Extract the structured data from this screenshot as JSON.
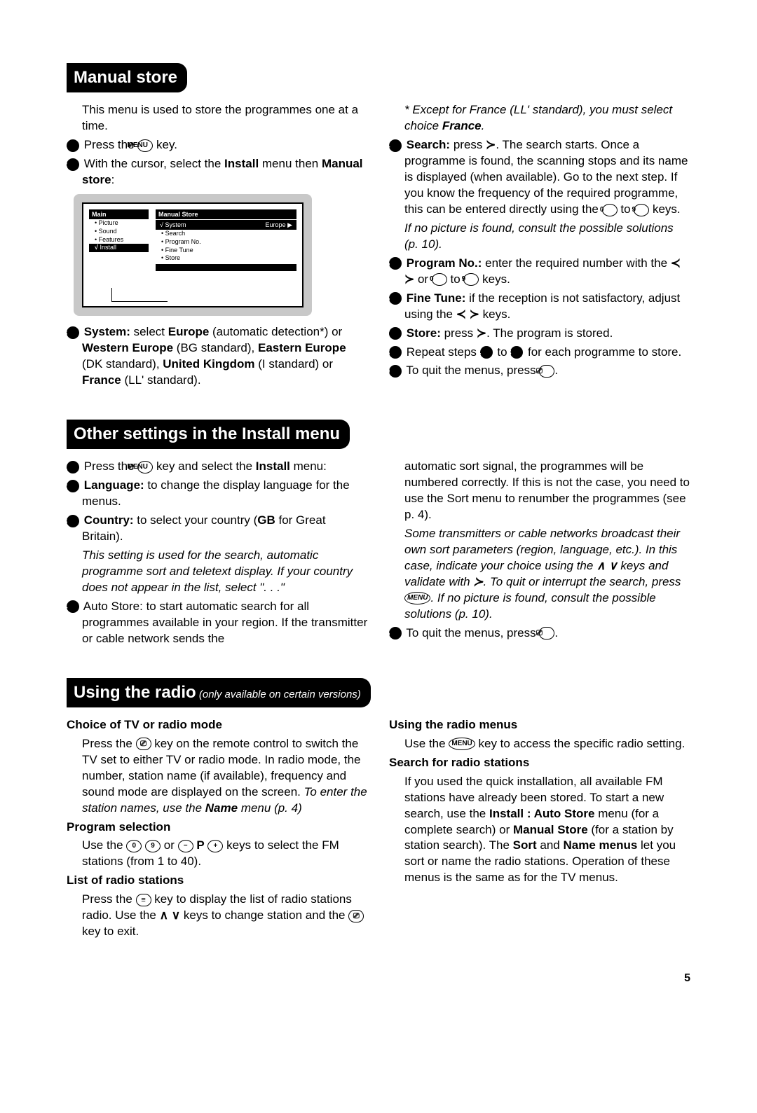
{
  "page_number": "5",
  "s1": {
    "title": "Manual store",
    "left": {
      "intro": "This menu is used to store the programmes one at a time.",
      "step1_a": "Press the ",
      "step1_key": "MENU",
      "step1_b": " key.",
      "step2_a": "With the cursor, select the ",
      "step2_bold1": "Install",
      "step2_b": " menu then ",
      "step2_bold2": "Manual store",
      "step2_c": ":",
      "step3_a": "System:",
      "step3_b": " select ",
      "step3_bold1": "Europe",
      "step3_c": " (automatic detection*) or ",
      "step3_bold2": "Western Europe",
      "step3_d": " (BG standard), ",
      "step3_bold3": "Eastern Europe",
      "step3_e": " (DK standard), ",
      "step3_bold4": "United Kingdom",
      "step3_f": " (I standard) or ",
      "step3_bold5": "France",
      "step3_g": " (LL' standard)."
    },
    "right": {
      "note_a": "* Except for France (LL' standard), you must select choice ",
      "note_bold": "France",
      "note_b": ".",
      "step4_a": "Search:",
      "step4_b": " press ",
      "step4_c": ". The search starts. Once a programme is found, the scanning stops and its name is displayed (when available). Go to the next step. If you know the frequency of the required programme, this can be entered directly using the ",
      "step4_d": " to ",
      "step4_e": " keys.",
      "step4_note": "If no picture is found, consult the possible solutions (p. 10).",
      "step5_a": "Program No.:",
      "step5_b": " enter the required number with the ",
      "step5_c": " or ",
      "step5_d": " to ",
      "step5_e": " keys.",
      "step6_a": "Fine Tune:",
      "step6_b": " if the reception is not satisfactory, adjust using the ",
      "step6_c": " keys.",
      "step7_a": "Store:",
      "step7_b": " press ",
      "step7_c": ". The program is stored.",
      "step8_a": "Repeat steps ",
      "step8_b": " to ",
      "step8_c": " for each programme to store.",
      "step9_a": "To quit the menus, press ",
      "step9_b": "."
    },
    "tv": {
      "main": "Main",
      "picture": "Picture",
      "sound": "Sound",
      "features": "Features",
      "install": "Install",
      "manual_store": "Manual Store",
      "system": "System",
      "europe": "Europe ▶",
      "search": "Search",
      "program_no": "Program No.",
      "fine_tune": "Fine Tune",
      "store": "Store"
    }
  },
  "s2": {
    "title": "Other settings in the Install menu",
    "left": {
      "step1_a": "Press the ",
      "step1_key": "MENU",
      "step1_b": " key and select the ",
      "step1_bold": "Install",
      "step1_c": " menu:",
      "step2_a": "Language:",
      "step2_b": " to change the display language for the menus.",
      "step3_a": "Country:",
      "step3_b": " to select your country (",
      "step3_bold": "GB",
      "step3_c": " for Great Britain).",
      "step3_note": "This setting is used for the search, automatic programme sort and teletext display. If your country does not appear in the list, select \". . .\"",
      "step4": "Auto Store: to start automatic search for all programmes available in your region. If the transmitter or cable network sends the"
    },
    "right": {
      "cont": "automatic sort signal, the programmes will be numbered correctly. If this is not the case, you need to use the Sort menu to renumber the programmes (see p. 4).",
      "note_a": "Some transmitters or cable networks broadcast their own sort parameters (region, language, etc.). In this case, indicate your choice using the ",
      "note_b": " keys and validate with ",
      "note_c": ". To quit or interrupt the search, press ",
      "note_key": "MENU",
      "note_d": ". If no picture is found, consult the possible solutions (p. 10).",
      "step5_a": "To quit the menus, press ",
      "step5_b": "."
    }
  },
  "s3": {
    "title_main": "Using the radio",
    "title_sub": " (only available on certain versions)",
    "left": {
      "h1": "Choice of TV or radio mode",
      "p1_a": "Press the ",
      "p1_b": " key on the remote control to switch the TV set to either TV or radio mode. In radio mode, the number, station name (if available), frequency and sound mode are displayed on the screen. ",
      "p1_ital_a": "To enter the station names, use the ",
      "p1_ital_bold": "Name",
      "p1_ital_b": " menu (p. 4)",
      "h2": "Program selection",
      "p2_a": "Use the ",
      "p2_b": " or ",
      "p2_pminus": "−",
      "p2_p": "P",
      "p2_pplus": "+",
      "p2_c": " keys to select the FM stations (from 1 to 40).",
      "h3": "List of radio stations",
      "p3_a": "Press the ",
      "p3_key": "≡",
      "p3_b": " key to display the list of radio stations radio. Use the ",
      "p3_c": " keys to change station and the ",
      "p3_d": " key to exit."
    },
    "right": {
      "h1": "Using the radio menus",
      "p1_a": "Use the ",
      "p1_key": "MENU",
      "p1_b": " key to access the specific radio setting.",
      "h2": "Search for radio stations",
      "p2_a": "If you used the quick installation, all available FM stations have already been stored. To start a new search, use the ",
      "p2_bold1": "Install : Auto Store",
      "p2_b": " menu (for a complete search) or ",
      "p2_bold2": "Manual Store",
      "p2_c": " (for a station by station search). The ",
      "p2_bold3": "Sort",
      "p2_d": " and ",
      "p2_bold4": "Name menus",
      "p2_e": " let you sort or name the radio stations. Operation of these menus is the same as for the TV menus."
    }
  },
  "keys": {
    "menu": "MENU",
    "k0": "0",
    "k9": "9",
    "list": "≡",
    "exit": "⎚",
    "tvradio": "⎚"
  }
}
